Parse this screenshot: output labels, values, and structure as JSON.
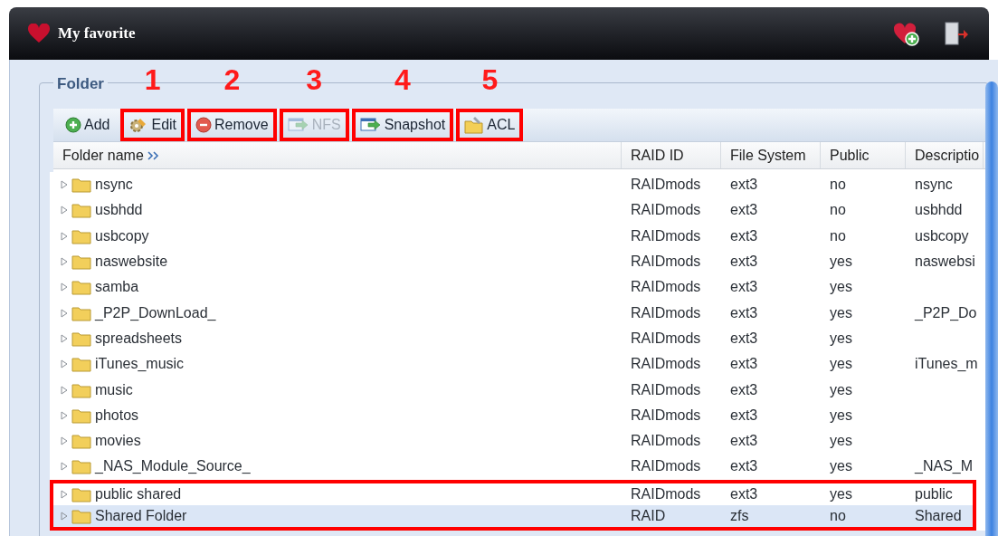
{
  "header": {
    "title": "My favorite"
  },
  "panel": {
    "legend": "Folder"
  },
  "toolbar": [
    {
      "label": "Add",
      "kind": "add",
      "disabled": false
    },
    {
      "label": "Edit",
      "kind": "edit",
      "disabled": false,
      "callout": "1"
    },
    {
      "label": "Remove",
      "kind": "remove",
      "disabled": false,
      "callout": "2"
    },
    {
      "label": "NFS",
      "kind": "nfs",
      "disabled": true,
      "callout": "3"
    },
    {
      "label": "Snapshot",
      "kind": "snapshot",
      "disabled": false,
      "callout": "4"
    },
    {
      "label": "ACL",
      "kind": "acl",
      "disabled": false,
      "callout": "5"
    }
  ],
  "table": {
    "columns": [
      "Folder name",
      "RAID ID",
      "File System",
      "Public",
      "Descriptio"
    ],
    "rows": [
      {
        "cells": [
          "nsync",
          "RAIDmods",
          "ext3",
          "no",
          "nsync"
        ],
        "selected": false,
        "highlighted": false
      },
      {
        "cells": [
          "usbhdd",
          "RAIDmods",
          "ext3",
          "no",
          "usbhdd"
        ],
        "selected": false,
        "highlighted": false
      },
      {
        "cells": [
          "usbcopy",
          "RAIDmods",
          "ext3",
          "no",
          "usbcopy"
        ],
        "selected": false,
        "highlighted": false
      },
      {
        "cells": [
          "naswebsite",
          "RAIDmods",
          "ext3",
          "yes",
          "naswebsi"
        ],
        "selected": false,
        "highlighted": false
      },
      {
        "cells": [
          "samba",
          "RAIDmods",
          "ext3",
          "yes",
          null
        ],
        "selected": false,
        "highlighted": false
      },
      {
        "cells": [
          "_P2P_DownLoad_",
          "RAIDmods",
          "ext3",
          "yes",
          "_P2P_Do"
        ],
        "selected": false,
        "highlighted": false
      },
      {
        "cells": [
          "spreadsheets",
          "RAIDmods",
          "ext3",
          "yes",
          null
        ],
        "selected": false,
        "highlighted": false
      },
      {
        "cells": [
          "iTunes_music",
          "RAIDmods",
          "ext3",
          "yes",
          "iTunes_m"
        ],
        "selected": false,
        "highlighted": false
      },
      {
        "cells": [
          "music",
          "RAIDmods",
          "ext3",
          "yes",
          null
        ],
        "selected": false,
        "highlighted": false
      },
      {
        "cells": [
          "photos",
          "RAIDmods",
          "ext3",
          "yes",
          null
        ],
        "selected": false,
        "highlighted": false
      },
      {
        "cells": [
          "movies",
          "RAIDmods",
          "ext3",
          "yes",
          null
        ],
        "selected": false,
        "highlighted": false
      },
      {
        "cells": [
          "_NAS_Module_Source_",
          "RAIDmods",
          "ext3",
          "yes",
          "_NAS_M"
        ],
        "selected": false,
        "highlighted": false
      },
      {
        "cells": [
          "public shared",
          "RAIDmods",
          "ext3",
          "yes",
          "public"
        ],
        "selected": false,
        "highlighted": true
      },
      {
        "cells": [
          "Shared Folder",
          "RAID",
          "zfs",
          "no",
          "Shared"
        ],
        "selected": true,
        "highlighted": true
      }
    ]
  }
}
